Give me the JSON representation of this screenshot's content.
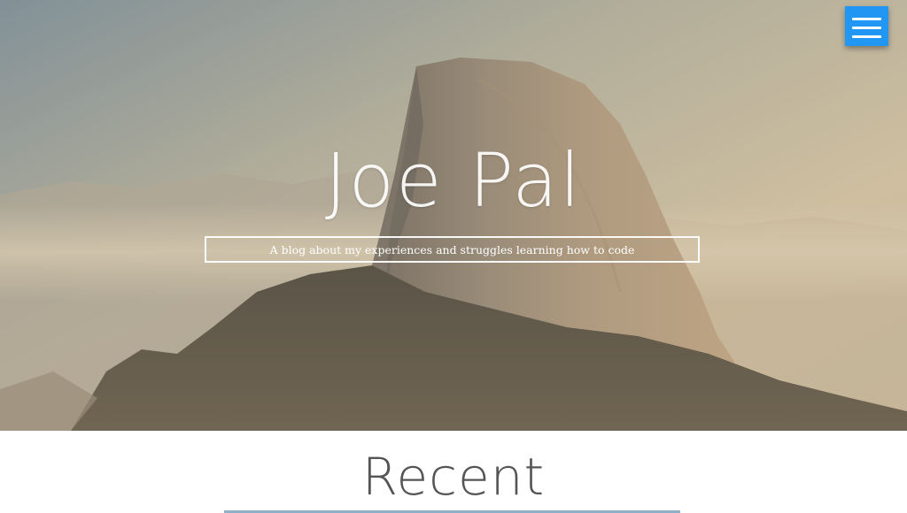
{
  "site": {
    "title": "Joe Pal",
    "tagline": "A blog about my experiences and struggles learning how to code"
  },
  "nav": {
    "menu_icon": "hamburger-menu-icon",
    "accent": "#2196f3"
  },
  "sections": {
    "recent_title": "Recent"
  },
  "hero": {
    "image_subject": "mountain-landscape"
  }
}
